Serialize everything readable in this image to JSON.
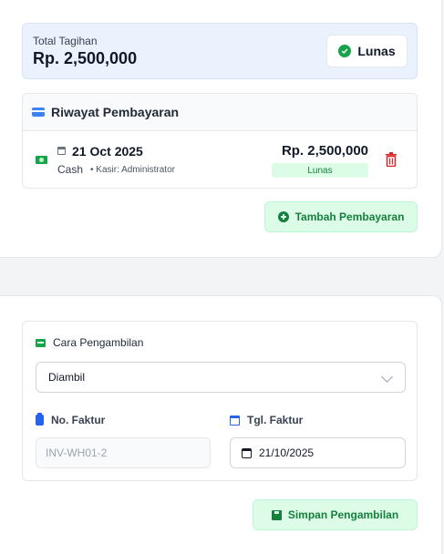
{
  "summary": {
    "total_label": "Total Tagihan",
    "total_amount": "Rp. 2,500,000",
    "status": "Lunas"
  },
  "payments": {
    "title": "Riwayat Pembayaran",
    "items": [
      {
        "date": "21 Oct 2025",
        "method": "Cash",
        "cashier": "• Kasir: Administrator",
        "amount": "Rp. 2,500,000",
        "status": "Lunas"
      }
    ],
    "add_button": "Tambah Pembayaran"
  },
  "pickup": {
    "title": "Cara Pengambilan",
    "method_selected": "Diambil",
    "invoice_label": "No. Faktur",
    "invoice_value": "INV-WH01-2",
    "date_label": "Tgl. Faktur",
    "date_value": "21/10/2025",
    "save_button": "Simpan Pengambilan"
  },
  "colors": {
    "accent_green": "#15803d",
    "success_bg": "#dcfce7",
    "info_bg": "#eaf2fe",
    "danger": "#dc2626",
    "primary_blue": "#2563eb"
  },
  "icons": [
    "check-circle-icon",
    "credit-card-icon",
    "money-icon",
    "calendar-icon",
    "trash-icon",
    "plus-circle-icon",
    "box-icon",
    "clipboard-icon",
    "chevron-down-icon",
    "save-icon"
  ]
}
